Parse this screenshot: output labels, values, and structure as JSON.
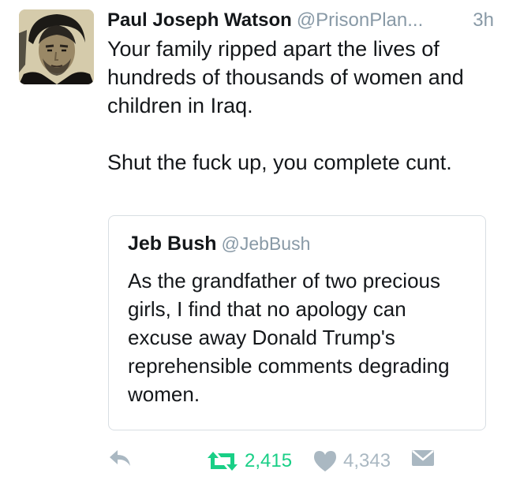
{
  "tweet": {
    "author": {
      "display_name": "Paul Joseph Watson",
      "handle": "@PrisonPlan...",
      "avatar_icon": "profile-photo"
    },
    "timestamp": "3h",
    "text_paragraphs": [
      "Your family ripped apart the lives of hundreds of thousands of women and children in Iraq.",
      "Shut the fuck up, you complete cunt."
    ],
    "quoted_tweet": {
      "display_name": "Jeb Bush",
      "handle": "@JebBush",
      "text": "As the grandfather of two precious girls, I find that no apology can excuse away Donald Trump's reprehensible comments degrading women."
    },
    "actions": {
      "reply_icon": "reply-icon",
      "retweet_icon": "retweet-icon",
      "retweet_count": "2,415",
      "like_icon": "heart-icon",
      "like_count": "4,343",
      "dm_icon": "envelope-icon"
    }
  },
  "colors": {
    "text": "#14171a",
    "muted": "#8899a6",
    "retweet_active": "#19cf86",
    "icon_grey": "#aab8c2",
    "quote_border": "#d8dee3"
  }
}
